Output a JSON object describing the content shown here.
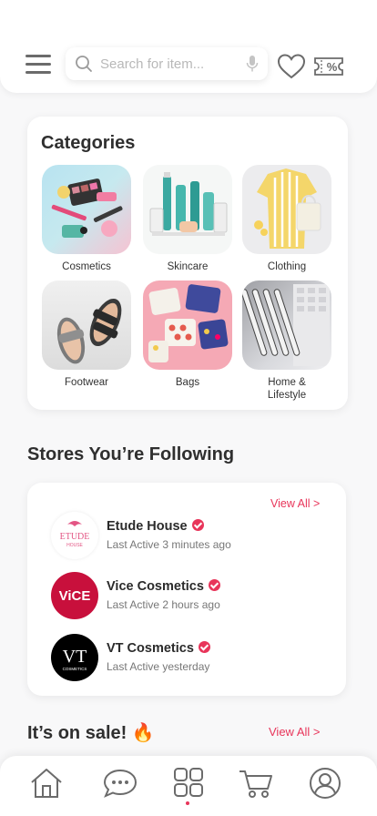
{
  "header": {
    "search_placeholder": "Search for item...",
    "icons": [
      "menu-icon",
      "search-icon",
      "microphone-icon",
      "heart-icon",
      "voucher-icon"
    ]
  },
  "categories": {
    "title": "Categories",
    "items": [
      {
        "label": "Cosmetics"
      },
      {
        "label": "Skincare"
      },
      {
        "label": "Clothing"
      },
      {
        "label": "Footwear"
      },
      {
        "label": "Bags"
      },
      {
        "label": "Home &\nLifestyle"
      }
    ]
  },
  "stores": {
    "title": "Stores You’re Following",
    "view_all": "View All >",
    "items": [
      {
        "name": "Etude House",
        "active": "Last Active 3 minutes ago",
        "logo_text": "ETUDE",
        "logo_sub": "HOUSE"
      },
      {
        "name": "Vice Cosmetics",
        "active": "Last Active 2 hours ago",
        "logo_text": "ViCE"
      },
      {
        "name": "VT Cosmetics",
        "active": "Last Active yesterday",
        "logo_text": "VT",
        "logo_sub": "COSMETICS"
      }
    ]
  },
  "sale": {
    "title": "It’s on sale! 🔥",
    "view_all": "View All >"
  },
  "bottom_nav": {
    "items": [
      "home-icon",
      "chat-icon",
      "categories-icon",
      "cart-icon",
      "profile-icon"
    ],
    "active": "categories-icon"
  },
  "colors": {
    "accent": "#e8355a",
    "icon_gray": "#6b6b6b"
  }
}
